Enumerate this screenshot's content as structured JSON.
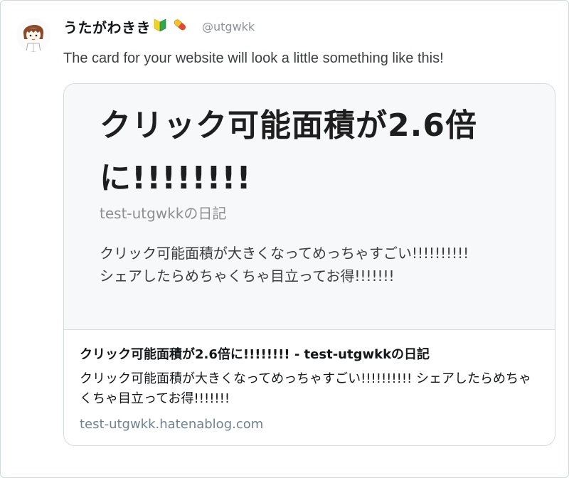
{
  "tweet": {
    "display_name": "うたがわきき",
    "handle": "@utgwkk",
    "text": "The card for your website will look a little something like this!"
  },
  "icons": {
    "avatar": "avatar-illustration",
    "badge": "beginner-mark-icon",
    "pill": "pill-icon"
  },
  "card": {
    "image": {
      "title": "クリック可能面積が2.6倍に!!!!!!!!",
      "blog_name": "test-utgwkkの日記",
      "description_line1": "クリック可能面積が大きくなってめっちゃすごい!!!!!!!!!!",
      "description_line2": "シェアしたらめちゃくちゃ目立ってお得!!!!!!!"
    },
    "title": "クリック可能面積が2.6倍に!!!!!!!! - test-utgwkkの日記",
    "description": "クリック可能面積が大きくなってめっちゃすごい!!!!!!!!!! シェアしたらめちゃくちゃ目立ってお得!!!!!!!",
    "domain": "test-utgwkk.hatenablog.com"
  },
  "colors": {
    "text": "#14171a",
    "muted": "#8a9299",
    "domain": "#6e8290",
    "card_border": "#d2dbe0",
    "image_bg": "#f7f8fa",
    "badge_green": "#2fa84f",
    "badge_yellow": "#f5d21f",
    "pill_red": "#e0493a",
    "pill_yellow": "#f4c430"
  }
}
